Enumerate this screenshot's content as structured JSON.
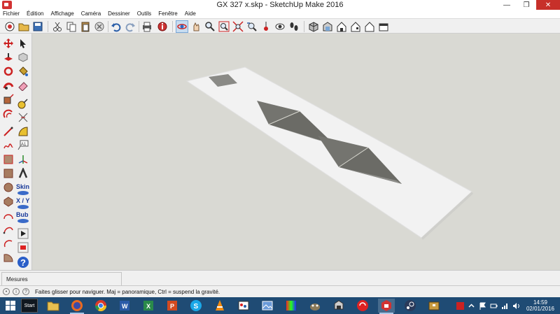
{
  "window": {
    "title": "GX 327 x.skp - SketchUp Make 2016",
    "minimize": "—",
    "maximize": "❐",
    "close": "✕"
  },
  "menu": {
    "items": [
      "Fichier",
      "Édition",
      "Affichage",
      "Caméra",
      "Dessiner",
      "Outils",
      "Fenêtre",
      "Aide"
    ]
  },
  "extensions": {
    "skin": "Skin",
    "xy": "X / Y",
    "bub": "Bub"
  },
  "measurements": {
    "label": "Mesures"
  },
  "status": {
    "message": "Faites glisser pour naviguer. Maj = panoramique, Ctrl =  suspend la gravité."
  },
  "taskbar": {
    "start_label": "Start",
    "time": "14:59",
    "date": "02/01/2016"
  },
  "colors": {
    "viewport_bg": "#d9d9d3",
    "slab": "#f2f2f2",
    "diamond": "#7c7c78",
    "taskbar": "#1f4b74",
    "close_button": "#c7302a"
  }
}
